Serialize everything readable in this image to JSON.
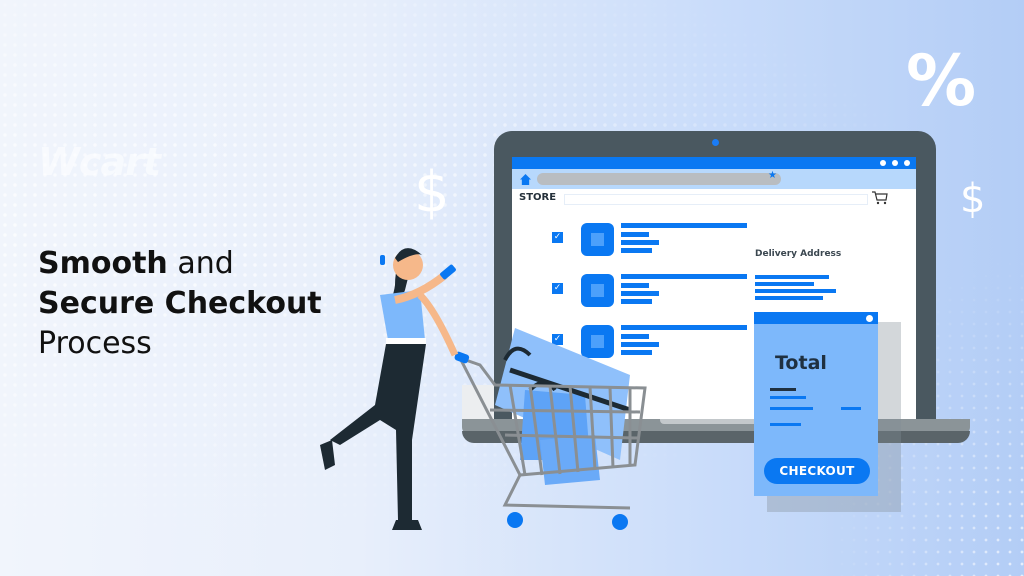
{
  "brand": {
    "logo_text": "Wcart"
  },
  "headline": {
    "line1_bold": "Smooth",
    "line1_thin": " and",
    "line2_bold": "Secure Checkout",
    "line3_thin": "Process"
  },
  "decorations": {
    "percent_symbol": "%",
    "dollar_symbol_left": "$",
    "dollar_symbol_right": "$"
  },
  "browser": {
    "store_label": "STORE",
    "delivery_label": "Delivery Address",
    "cart_items_checked": [
      true,
      true,
      true
    ]
  },
  "receipt": {
    "title": "Total",
    "checkout_label": "CHECKOUT"
  },
  "colors": {
    "accent": "#0a78f2",
    "light_accent": "#7db8fb",
    "laptop_frame": "#4a5860",
    "text_dark": "#111111"
  }
}
